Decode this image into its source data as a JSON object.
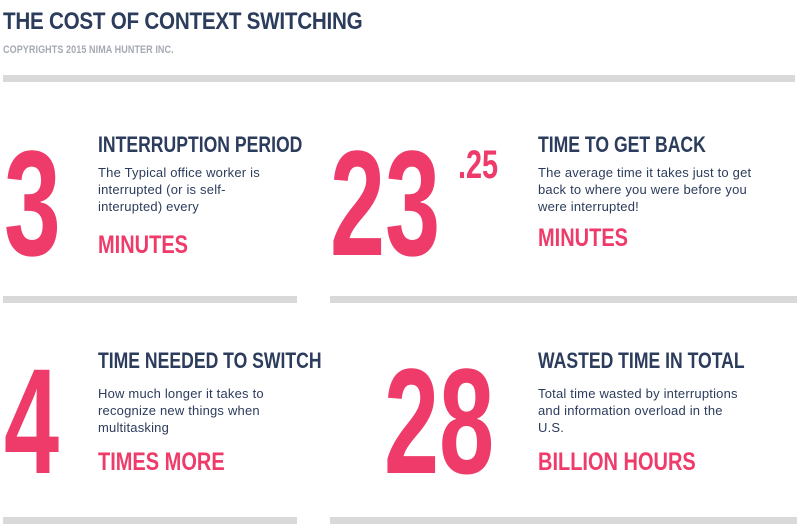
{
  "header": {
    "title": "THE COST OF CONTEXT SWITCHING",
    "subtitle": "COPYRIGHTS 2015 NIMA HUNTER INC."
  },
  "colors": {
    "accent": "#ee3b6a",
    "text": "#2c3c5c",
    "muted": "#a5a9b3",
    "rule": "#d9d9d9"
  },
  "stats": [
    {
      "number": "3",
      "heading": "INTERRUPTION PERIOD",
      "description": "The Typical office worker is interrupted (or is self-interupted) every",
      "unit": "MINUTES"
    },
    {
      "number": "23",
      "number_superscript": ".25",
      "heading": "TIME TO GET BACK",
      "description": "The average time it takes just to get back to where you were before you were interrupted!",
      "unit": "MINUTES"
    },
    {
      "number": "4",
      "heading": "TIME NEEDED TO SWITCH",
      "description": "How much longer it takes to recognize new things when multitasking",
      "unit": "TIMES MORE"
    },
    {
      "number": "28",
      "heading": "WASTED TIME IN TOTAL",
      "description": "Total time wasted by interruptions and information overload in the U.S.",
      "unit": "BILLION HOURS"
    }
  ]
}
